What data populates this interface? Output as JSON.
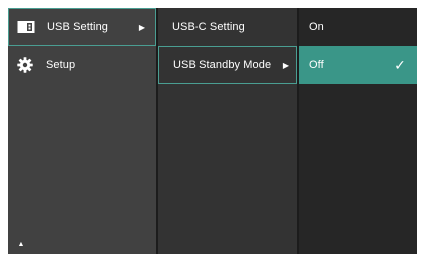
{
  "menu": {
    "level1": [
      {
        "label": "USB Setting",
        "icon": "usb-setting-icon",
        "has_submenu": true,
        "state": "active"
      },
      {
        "label": "Setup",
        "icon": "gear-icon",
        "has_submenu": false,
        "state": "normal"
      }
    ],
    "level2": [
      {
        "label": "USB-C Setting",
        "has_submenu": false,
        "state": "normal"
      },
      {
        "label": "USB Standby Mode",
        "has_submenu": true,
        "state": "active"
      }
    ],
    "level3": [
      {
        "label": "On",
        "checked": false,
        "state": "normal"
      },
      {
        "label": "Off",
        "checked": true,
        "state": "selected"
      }
    ],
    "glyphs": {
      "submenu_arrow": "▶",
      "check": "✓",
      "scroll_up": "▲"
    }
  },
  "colors": {
    "highlight": "#3a9688",
    "highlight_border": "#4a9e92",
    "col1_bg": "#414141",
    "col2_bg": "#333333",
    "col3_bg": "#262626"
  }
}
